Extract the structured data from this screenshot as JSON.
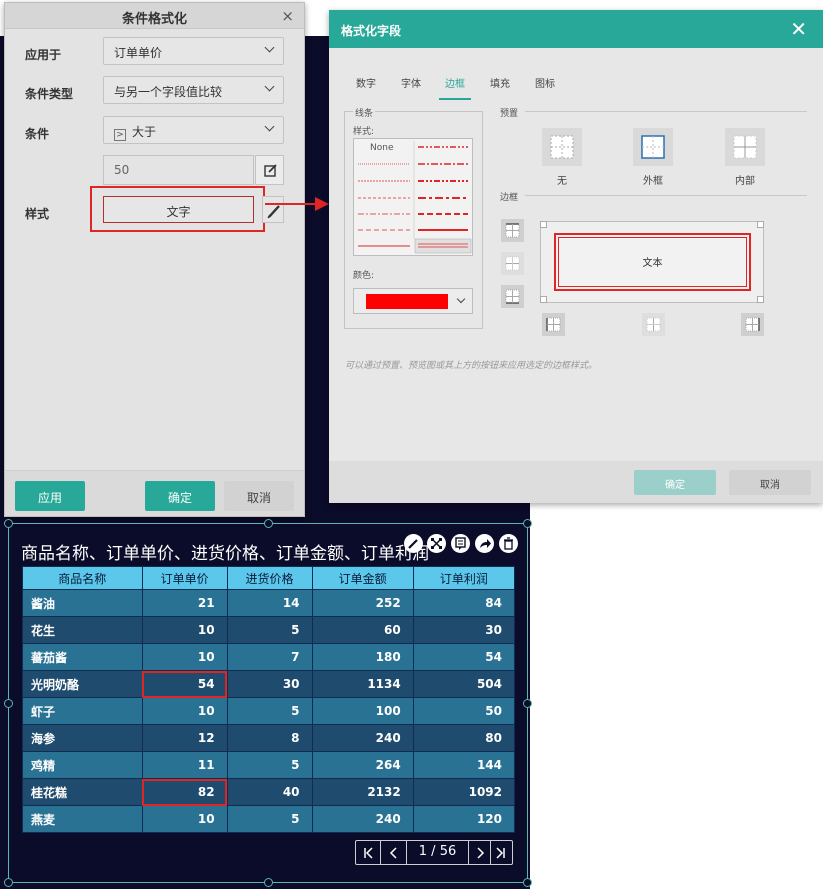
{
  "cond_dialog": {
    "title": "条件格式化",
    "close_glyph": "×",
    "apply_to_label": "应用于",
    "apply_to_value": "订单单价",
    "cond_type_label": "条件类型",
    "cond_type_value": "与另一个字段值比较",
    "condition_label": "条件",
    "condition_op_glyph": ">",
    "condition_value": "大于",
    "compare_value": "50",
    "style_label": "样式",
    "style_button": "文字",
    "apply_btn": "应用",
    "ok_btn": "确定",
    "cancel_btn": "取消"
  },
  "fmt_dialog": {
    "title": "格式化字段",
    "close_glyph": "✕",
    "tabs": [
      "数字",
      "字体",
      "边框",
      "填充",
      "图标"
    ],
    "active_tab": "边框",
    "line_section": "线条",
    "style_label": "样式:",
    "none_label": "None",
    "color_label": "颜色:",
    "color_value": "#ff0000",
    "preset_section": "预置",
    "presets": [
      "无",
      "外框",
      "内部"
    ],
    "border_section": "边框",
    "preview_text": "文本",
    "hint": "可以通过预置、预览图或其上方的按钮来应用选定的边框样式。",
    "ok_btn": "确定",
    "cancel_btn": "取消"
  },
  "table_widget": {
    "title": "商品名称、订单单价、进货价格、订单金额、订单利润",
    "columns": [
      "商品名称",
      "订单单价",
      "进货价格",
      "订单金额",
      "订单利润"
    ],
    "rows": [
      [
        "酱油",
        "21",
        "14",
        "252",
        "84"
      ],
      [
        "花生",
        "10",
        "5",
        "60",
        "30"
      ],
      [
        "蕃茄酱",
        "10",
        "7",
        "180",
        "54"
      ],
      [
        "光明奶酪",
        "54",
        "30",
        "1134",
        "504"
      ],
      [
        "虾子",
        "10",
        "5",
        "100",
        "50"
      ],
      [
        "海参",
        "12",
        "8",
        "240",
        "80"
      ],
      [
        "鸡精",
        "11",
        "5",
        "264",
        "144"
      ],
      [
        "桂花糕",
        "82",
        "40",
        "2132",
        "1092"
      ],
      [
        "燕麦",
        "10",
        "5",
        "240",
        "120"
      ]
    ],
    "pager": {
      "current": "1",
      "total": "56",
      "separator": "/"
    },
    "highlight_color": "#e02525"
  }
}
